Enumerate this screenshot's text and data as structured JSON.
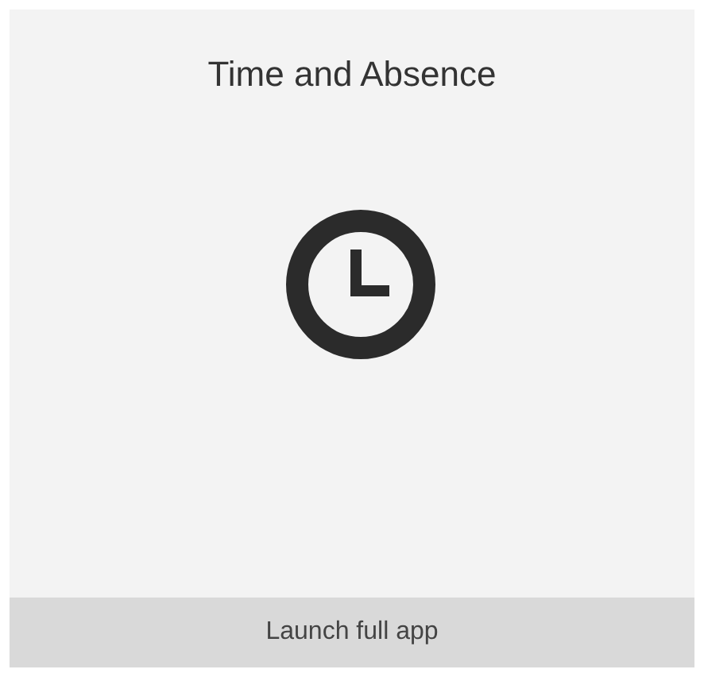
{
  "tile": {
    "title": "Time and Absence"
  },
  "footer": {
    "link": "Launch full app"
  }
}
